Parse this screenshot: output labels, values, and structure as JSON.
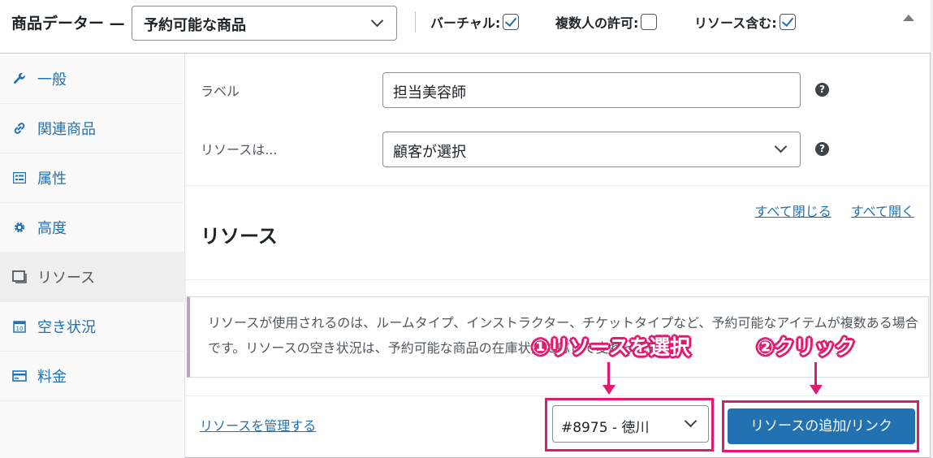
{
  "header": {
    "title": "商品データー —",
    "product_type": "予約可能な商品",
    "options": [
      {
        "label": "バーチャル:",
        "checked": true
      },
      {
        "label": "複数人の許可:",
        "checked": false
      },
      {
        "label": "リソース含む:",
        "checked": true
      }
    ]
  },
  "sidebar": {
    "items": [
      {
        "label": "一般",
        "icon": "wrench-icon"
      },
      {
        "label": "関連商品",
        "icon": "link-icon"
      },
      {
        "label": "属性",
        "icon": "list-icon"
      },
      {
        "label": "高度",
        "icon": "gear-icon"
      },
      {
        "label": "リソース",
        "icon": "window-icon",
        "active": true
      },
      {
        "label": "空き状況",
        "icon": "calendar-icon"
      },
      {
        "label": "料金",
        "icon": "card-icon"
      }
    ]
  },
  "form": {
    "label_field": {
      "label": "ラベル",
      "value": "担当美容師"
    },
    "resource_field": {
      "label": "リソースは...",
      "value": "顧客が選択"
    },
    "help_glyph": "?"
  },
  "resources": {
    "close_all": "すべて閉じる",
    "open_all": "すべて開く",
    "title": "リソース",
    "notice": "リソースが使用されるのは、ルームタイプ、インストラクター、チケットタイプなど、予約可能なアイテムが複数ある場合です。リソースの空き状況は、予約可能な商品の在庫状況に応じて変わっています。",
    "manage_link": "リソースを管理する",
    "selected_resource": "#8975 - 徳川",
    "add_button": "リソースの追加/リンク"
  },
  "annotations": {
    "step1": "①リソースを選択",
    "step2": "②クリック",
    "color": "#e3196e"
  },
  "colors": {
    "link": "#2271b1",
    "button": "#2271b1",
    "notice_border": "#c59ec8"
  }
}
